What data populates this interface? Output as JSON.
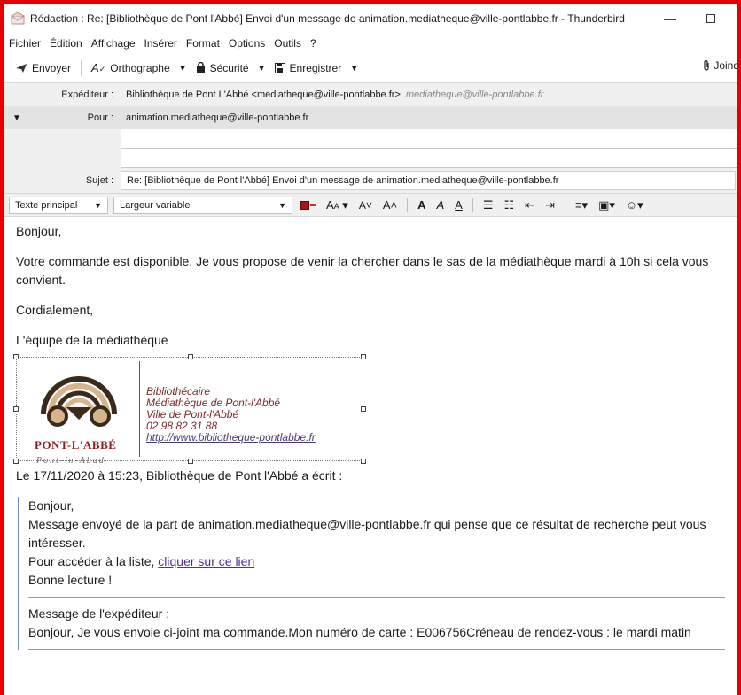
{
  "window": {
    "title": "Rédaction : Re: [Bibliothèque de Pont l'Abbé] Envoi d'un message de animation.mediatheque@ville-pontlabbe.fr - Thunderbird",
    "minimize": "—"
  },
  "menu": [
    {
      "label": "Fichier"
    },
    {
      "label": "Édition"
    },
    {
      "label": "Affichage"
    },
    {
      "label": "Insérer"
    },
    {
      "label": "Format"
    },
    {
      "label": "Options"
    },
    {
      "label": "Outils"
    },
    {
      "label": "?"
    }
  ],
  "toolbar": {
    "send": "Envoyer",
    "spelling": "Orthographe",
    "security": "Sécurité",
    "save": "Enregistrer",
    "attach": "Joind"
  },
  "headers": {
    "from_label": "Expéditeur :",
    "from_value": "Bibliothèque de Pont L'Abbé <mediatheque@ville-pontlabbe.fr>",
    "from_alias": "mediatheque@ville-pontlabbe.fr",
    "to_label": "Pour :",
    "to_value": "animation.mediatheque@ville-pontlabbe.fr",
    "subject_label": "Sujet :",
    "subject_value": "Re: [Bibliothèque de Pont l'Abbé] Envoi d'un message de animation.mediatheque@ville-pontlabbe.fr"
  },
  "format": {
    "paragraph": "Texte principal",
    "font": "Largeur variable"
  },
  "body": {
    "greeting": "Bonjour,",
    "line1": "Votre commande est  disponible. Je vous propose de venir la chercher dans le sas de la médiathèque mardi à 10h si cela vous convient.",
    "closing": "Cordialement,",
    "team": "L'équipe de la médiathèque"
  },
  "signature": {
    "logo_name": "PONT-L'ABBÉ",
    "logo_sub": "Pont-'n-Abad",
    "role": "Bibliothécaire",
    "org": "Médiathèque de Pont-l'Abbé",
    "city": "Ville de Pont-l'Abbé",
    "phone": "02 98 82 31 88",
    "url": "http://www.bibliotheque-pontlabbe.fr"
  },
  "quote": {
    "intro": "Le 17/11/2020 à 15:23, Bibliothèque de Pont l'Abbé a écrit :",
    "greeting": "Bonjour,",
    "message": "Message envoyé de la part de animation.mediatheque@ville-pontlabbe.fr qui pense que ce résultat de recherche peut vous intéresser.",
    "list_text": "Pour accéder à la liste, ",
    "list_link": "cliquer sur ce lien",
    "enjoy": "Bonne lecture !",
    "sender_label": "Message de l'expéditeur :",
    "sender_message": "Bonjour, Je vous envoie ci-joint ma commande.Mon numéro de carte : E006756Créneau de rendez-vous : le mardi matin"
  }
}
